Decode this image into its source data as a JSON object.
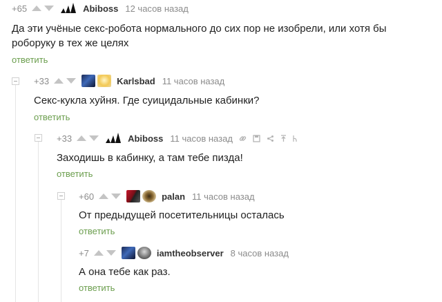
{
  "comments": [
    {
      "rating": "+65",
      "user": "Abiboss",
      "time": "12 часов назад",
      "text": "Да эти учёные секс-робота нормального до сих пор не изобрели, или хотя бы роборуку в тех же целях",
      "reply": "ответить"
    },
    {
      "rating": "+33",
      "user": "Karlsbad",
      "time": "11 часов назад",
      "text": "Секс-кукла хуйня. Где суицидальные кабинки?",
      "reply": "ответить"
    },
    {
      "rating": "+33",
      "user": "Abiboss",
      "time": "11 часов назад",
      "text": "Заходишь в кабинку, а там тебе пизда!",
      "reply": "ответить"
    },
    {
      "rating": "+60",
      "user": "palan",
      "time": "11 часов назад",
      "text": "От предыдущей посетительницы осталась",
      "reply": "ответить"
    },
    {
      "rating": "+7",
      "user": "iamtheobserver",
      "time": "8 часов назад",
      "text": "А она тебе как раз.",
      "reply": "ответить"
    }
  ],
  "colors": {
    "reply": "#6b9e4e",
    "meta": "#8b8b8b",
    "username": "#333333",
    "vote_arrow": "#c4c4c4",
    "thread_line": "#e4e4e4"
  },
  "icons": [
    "upvote-icon",
    "downvote-icon",
    "collapse-icon",
    "link-icon",
    "save-icon",
    "share-icon",
    "scroll-up-icon",
    "more-icon"
  ]
}
